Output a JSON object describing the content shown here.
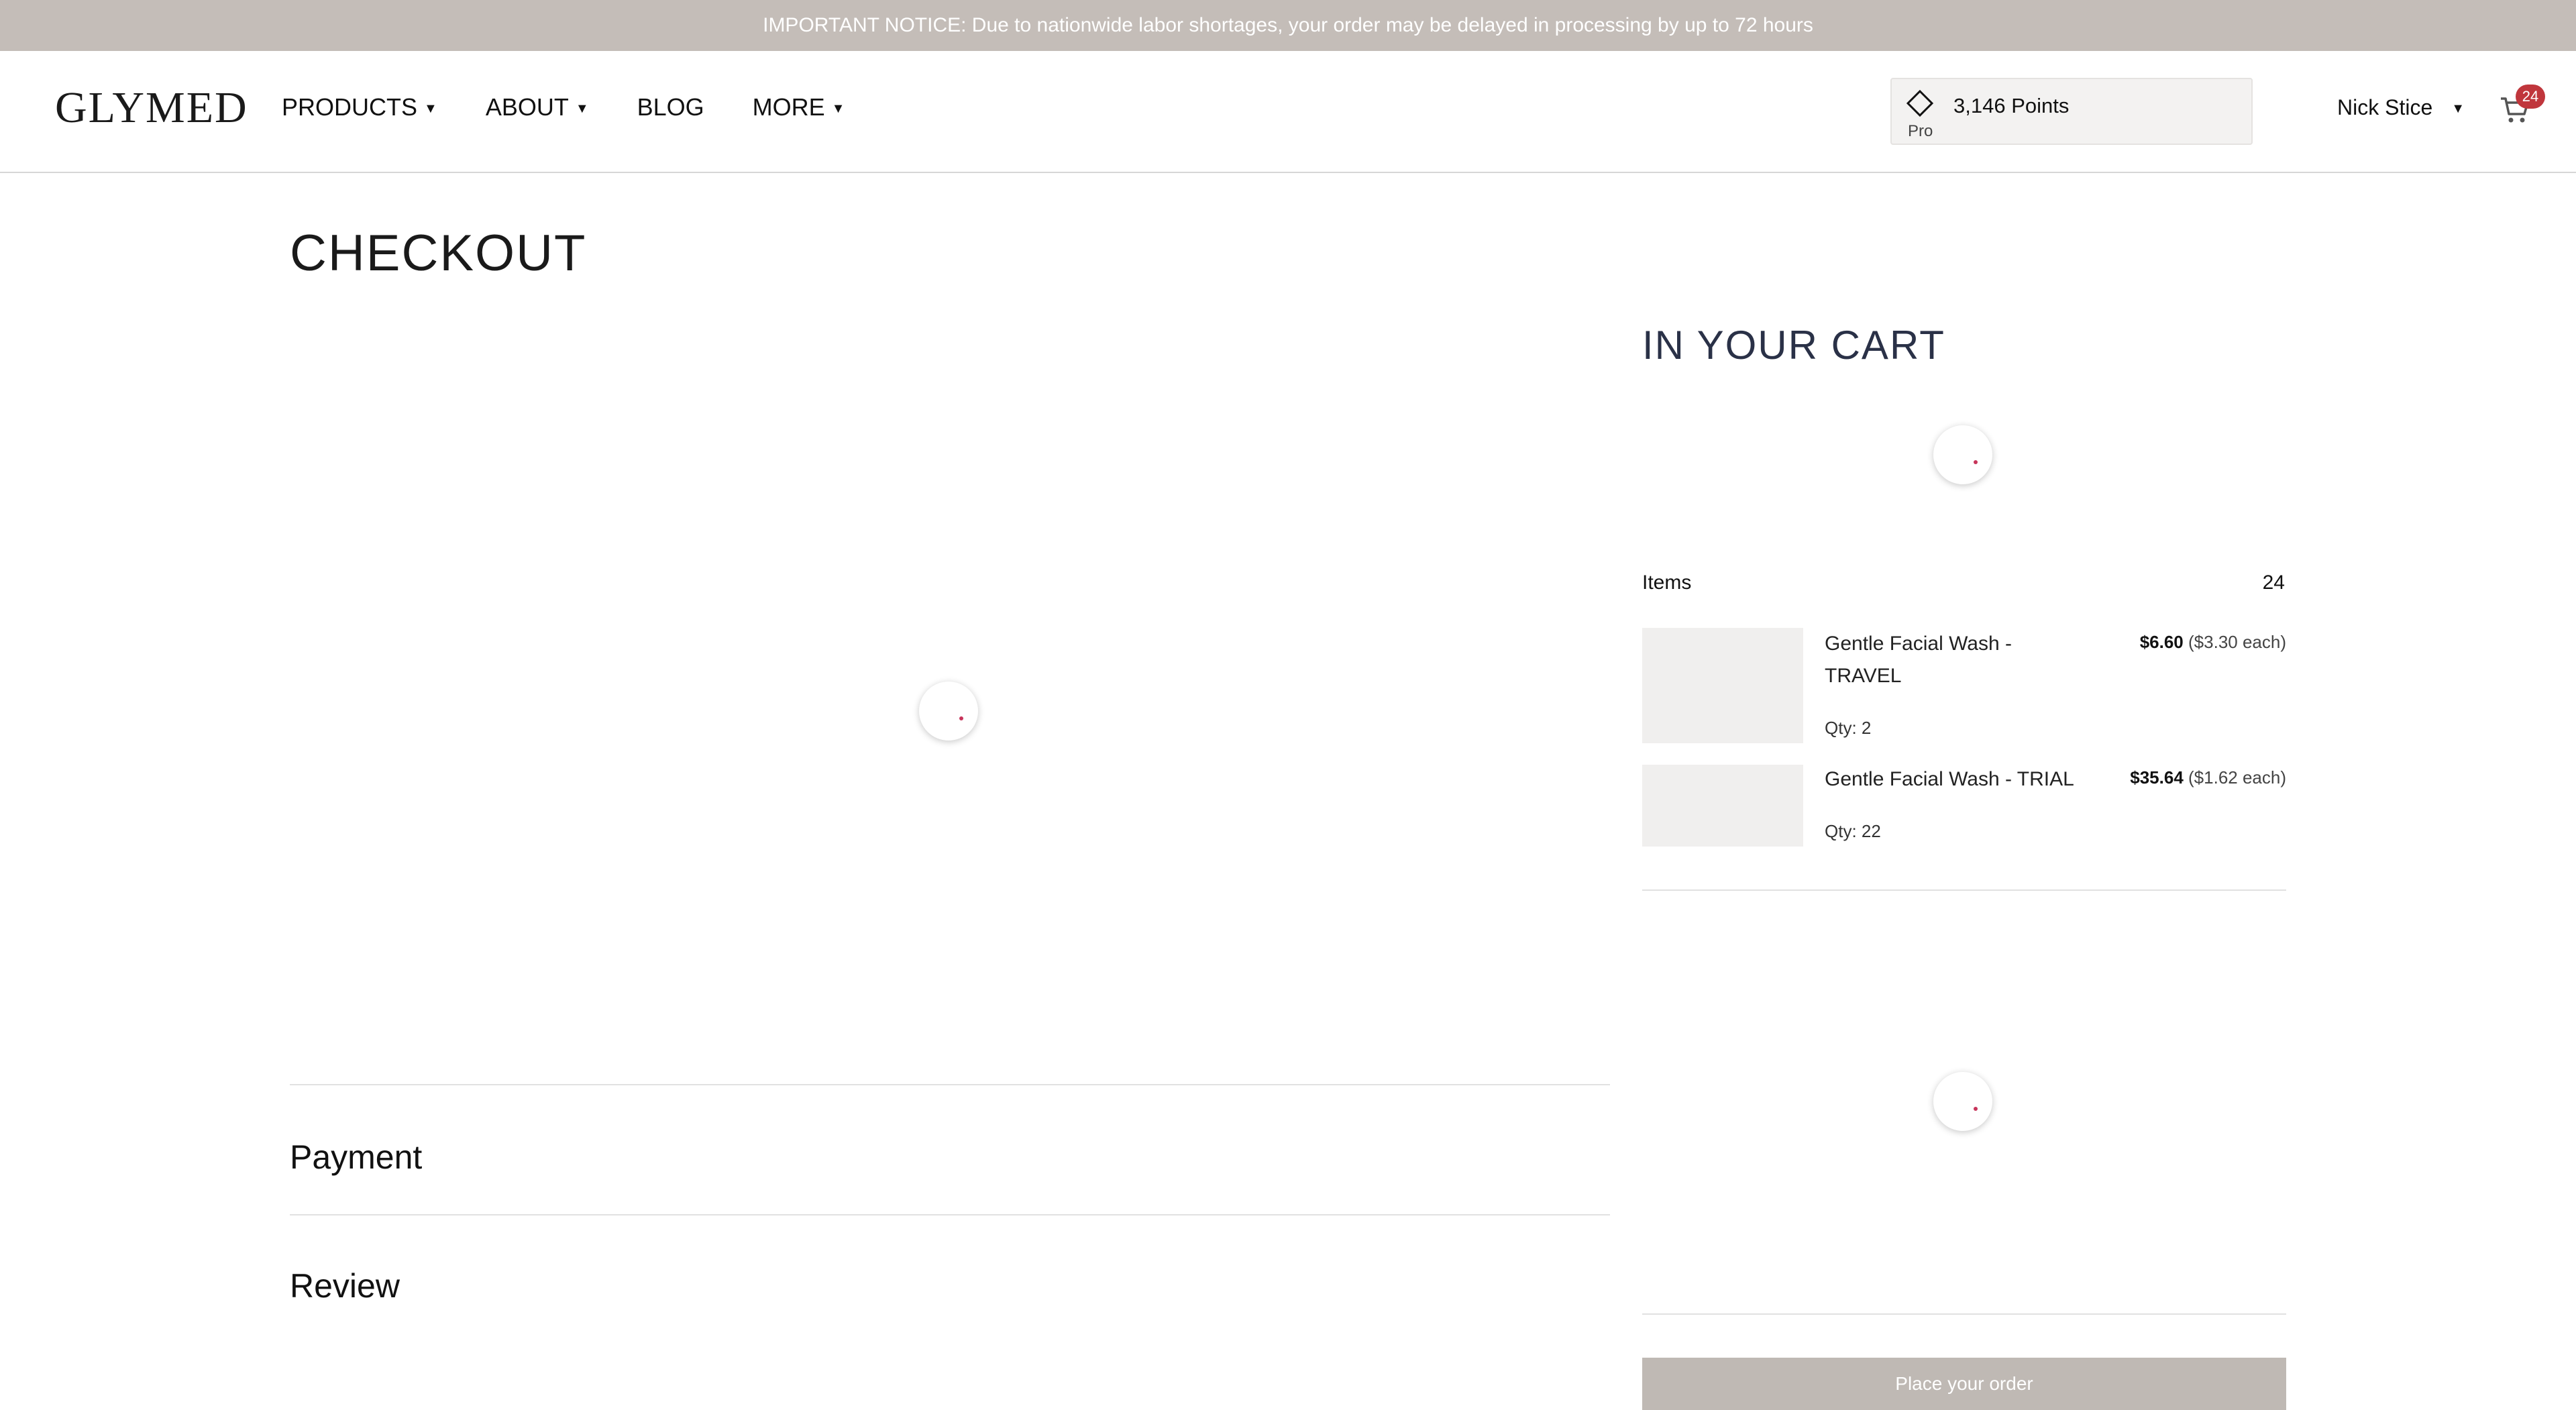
{
  "notice": {
    "text": "IMPORTANT NOTICE: Due to nationwide labor shortages, your order may be delayed in processing by up to 72 hours"
  },
  "header": {
    "logo": "GLYMED",
    "nav": [
      {
        "label": "PRODUCTS",
        "dropdown": true
      },
      {
        "label": "ABOUT",
        "dropdown": true
      },
      {
        "label": "BLOG",
        "dropdown": false
      },
      {
        "label": "MORE",
        "dropdown": true
      }
    ],
    "points": {
      "value": "3,146 Points",
      "tier": "Pro",
      "icon": "diamond-icon"
    },
    "user": {
      "name": "Nick Stice"
    },
    "cart": {
      "count": "24",
      "icon": "cart-icon"
    }
  },
  "checkout": {
    "title": "CHECKOUT",
    "sections": {
      "payment": "Payment",
      "review": "Review"
    }
  },
  "cart": {
    "title": "IN YOUR CART",
    "items_label": "Items",
    "items_count": "24",
    "products": [
      {
        "name": "Gentle Facial Wash - TRAVEL",
        "qty": "Qty: 2",
        "total": "$6.60",
        "each": "($3.30 each)"
      },
      {
        "name": "Gentle Facial Wash - TRIAL",
        "qty": "Qty: 22",
        "total": "$35.64",
        "each": "($1.62 each)"
      }
    ],
    "place_order": "Place your order"
  },
  "colors": {
    "notice_bg": "#c4bdb8",
    "badge": "#c0363c",
    "button_disabled": "#bfb9b4",
    "cart_title": "#2a3147",
    "spinner_dot": "#c7345a"
  }
}
